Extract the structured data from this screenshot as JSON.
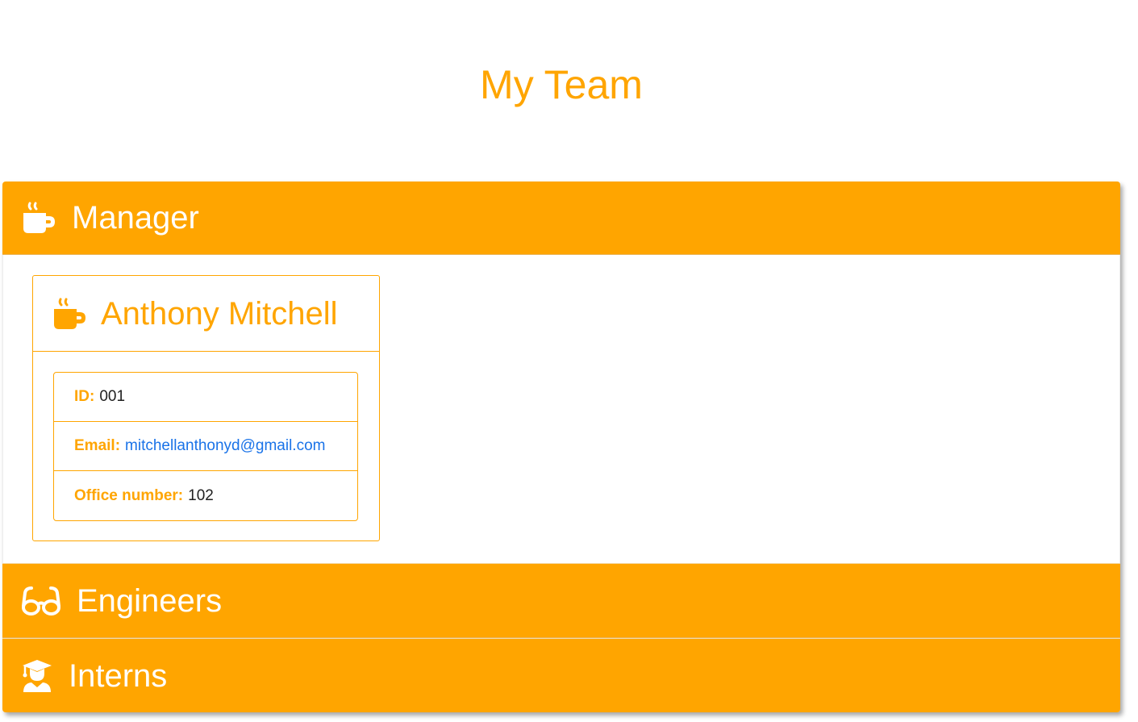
{
  "page": {
    "title": "My Team"
  },
  "colors": {
    "accent": "#ffa500",
    "link": "#1a73e8",
    "text": "#212121"
  },
  "sections": {
    "manager": {
      "label": "Manager",
      "icon": "coffee-mug-icon"
    },
    "engineers": {
      "label": "Engineers",
      "icon": "glasses-icon"
    },
    "interns": {
      "label": "Interns",
      "icon": "graduate-icon"
    }
  },
  "manager_card": {
    "name": "Anthony Mitchell",
    "icon": "coffee-mug-icon",
    "id_label": "ID:",
    "id_value": "001",
    "email_label": "Email:",
    "email_value": "mitchellanthonyd@gmail.com",
    "office_label": "Office number:",
    "office_value": "102"
  }
}
